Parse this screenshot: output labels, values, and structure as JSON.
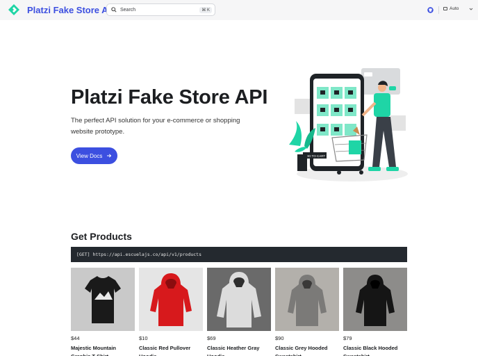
{
  "header": {
    "brand": "Platzi Fake Store API",
    "search_placeholder": "Search",
    "search_shortcut": "⌘ K",
    "theme_label": "Auto",
    "logo_color": "#1fd5a6",
    "accent_color": "#3c4fe0"
  },
  "hero": {
    "title": "Platzi Fake Store API",
    "subtitle": "The perfect API solution for your e-commerce or shopping website prototype.",
    "cta_label": "View Docs",
    "illustration_label": "ADD TO CART"
  },
  "products_section": {
    "title": "Get Products",
    "endpoint": "[GET] https://api.escuelajs.co/api/v1/products",
    "items": [
      {
        "price": "$44",
        "name": "Majestic Mountain Graphic T-Shirt",
        "image": "black-tshirt",
        "bg": "#c9c9c9"
      },
      {
        "price": "$10",
        "name": "Classic Red Pullover Hoodie",
        "image": "red-hoodie",
        "bg": "#e5e5e5"
      },
      {
        "price": "$69",
        "name": "Classic Heather Gray Hoodie",
        "image": "gray-hoodie",
        "bg": "#6a6a6a"
      },
      {
        "price": "$90",
        "name": "Classic Grey Hooded Sweatshirt",
        "image": "grey-hooded-sweatshirt",
        "bg": "#b3b0ab"
      },
      {
        "price": "$79",
        "name": "Classic Black Hooded Sweatshirt",
        "image": "black-hoodie",
        "bg": "#8d8c8a"
      }
    ]
  }
}
